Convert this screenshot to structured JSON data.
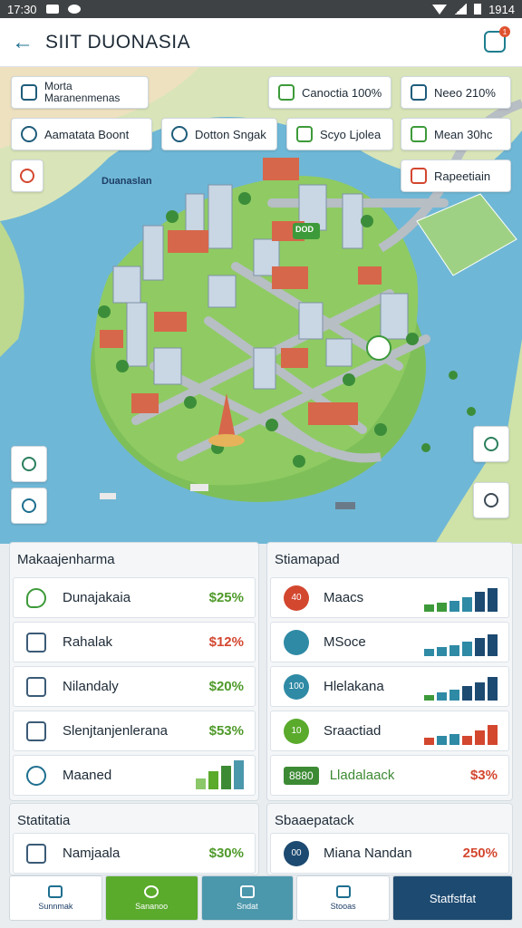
{
  "status_bar": {
    "time": "17:30",
    "right_text": "1914"
  },
  "app_bar": {
    "title": "SIIT DUONASIA",
    "notif_count": "1"
  },
  "map": {
    "chips": [
      {
        "line1": "Morta",
        "line2": "Maranenmenas"
      },
      {
        "label": "Canoctia 100%"
      },
      {
        "label": "Neeo 210%"
      },
      {
        "label": "Aamatata Boont"
      },
      {
        "label": "Dotton Sngak"
      },
      {
        "label": "Scyo Ljolea"
      },
      {
        "label": "Mean 30hc"
      },
      {
        "label": "Rapeetiain"
      }
    ],
    "area_label": "Duanaslan",
    "pin_label": "DOD"
  },
  "left_panel": {
    "title": "Makaajenharma",
    "rows": [
      {
        "label": "Dunajakaia",
        "value": "$25%"
      },
      {
        "label": "Rahalak",
        "value": "$12%"
      },
      {
        "label": "Nilandaly",
        "value": "$20%"
      },
      {
        "label": "Slenjtanjenlerana",
        "value": "$53%"
      },
      {
        "label": "Maaned"
      }
    ]
  },
  "right_panel": {
    "title": "Stiamapad",
    "rows": [
      {
        "label": "Maacs",
        "badge": "40"
      },
      {
        "label": "MSoce",
        "badge": ""
      },
      {
        "label": "Hlelakana",
        "badge": "100"
      },
      {
        "label": "Sraactiad",
        "badge": "10"
      },
      {
        "label": "Lladalaack",
        "badge": "8880",
        "value": "$3%"
      }
    ]
  },
  "left_panel2": {
    "title": "Statitatia",
    "rows": [
      {
        "label": "Namjaala",
        "value": "$30%"
      }
    ]
  },
  "right_panel2": {
    "title": "Sbaaepatack",
    "rows": [
      {
        "label": "Miana Nandan",
        "badge": "00",
        "value": "250%"
      }
    ]
  },
  "bottom_nav": [
    {
      "label": "Sunnmak"
    },
    {
      "label": "Sananoo"
    },
    {
      "label": "Sndat"
    },
    {
      "label": "Stooas"
    },
    {
      "label": "Statfstfat"
    }
  ],
  "colors": {
    "accent_green": "#5aaa2c",
    "accent_teal": "#4b97ac",
    "accent_navy": "#1d4a71",
    "value_red": "#d3472f",
    "value_green": "#4f9a2a"
  },
  "icons": [
    "back-arrow-icon",
    "notification-icon",
    "search-icon",
    "location-icon",
    "settings-gear-icon",
    "home-icon"
  ]
}
